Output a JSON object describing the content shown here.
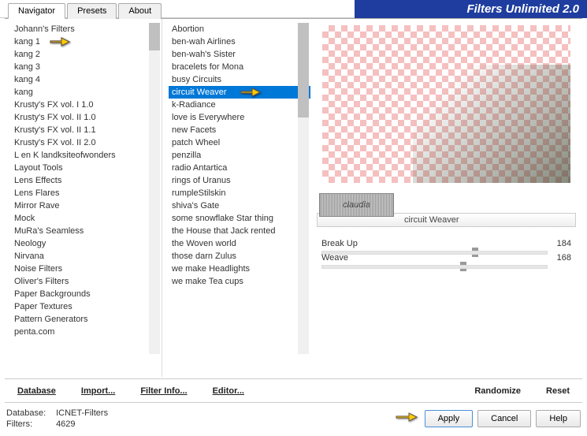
{
  "header": {
    "title": "Filters Unlimited 2.0"
  },
  "tabs": [
    {
      "label": "Navigator",
      "active": true
    },
    {
      "label": "Presets",
      "active": false
    },
    {
      "label": "About",
      "active": false
    }
  ],
  "categories": [
    "Johann's Filters",
    "kang 1",
    "kang 2",
    "kang 3",
    "kang 4",
    "kang",
    "Krusty's FX vol. I 1.0",
    "Krusty's FX vol. II 1.0",
    "Krusty's FX vol. II 1.1",
    "Krusty's FX vol. II 2.0",
    "L en K landksiteofwonders",
    "Layout Tools",
    "Lens Effects",
    "Lens Flares",
    "Mirror Rave",
    "Mock",
    "MuRa's Seamless",
    "Neology",
    "Nirvana",
    "Noise Filters",
    "Oliver's Filters",
    "Paper Backgrounds",
    "Paper Textures",
    "Pattern Generators",
    "penta.com"
  ],
  "categories_pointer_index": 1,
  "filters": [
    "Abortion",
    "ben-wah Airlines",
    "ben-wah's Sister",
    "bracelets for Mona",
    "busy Circuits",
    "circuit Weaver",
    "k-Radiance",
    "love is Everywhere",
    "new Facets",
    "patch Wheel",
    "penzilla",
    "radio Antartica",
    "rings of Uranus",
    "rumpleStilskin",
    "shiva's Gate",
    "some snowflake Star thing",
    "the House that Jack rented",
    "the Woven world",
    "those darn Zulus",
    "we make Headlights",
    "we make Tea cups"
  ],
  "filters_selected_index": 5,
  "current_filter_name": "circuit Weaver",
  "watermark": "claudia",
  "params": [
    {
      "name": "Break Up",
      "value": 184,
      "pos": 0.72
    },
    {
      "name": "Weave",
      "value": 168,
      "pos": 0.66
    }
  ],
  "toolbar": {
    "database": "Database",
    "import": "Import...",
    "filter_info": "Filter Info...",
    "editor": "Editor...",
    "randomize": "Randomize",
    "reset": "Reset"
  },
  "footer": {
    "db_label": "Database:",
    "db_value": "ICNET-Filters",
    "filters_label": "Filters:",
    "filters_value": "4629",
    "apply": "Apply",
    "cancel": "Cancel",
    "help": "Help"
  }
}
